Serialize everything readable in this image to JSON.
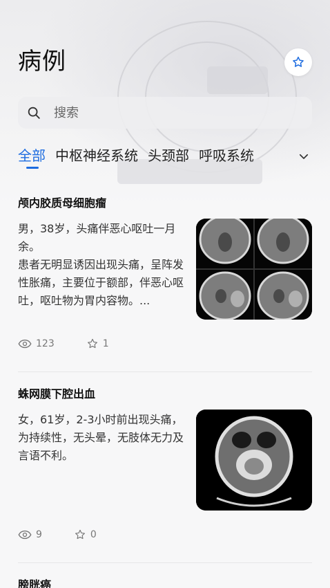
{
  "page": {
    "title": "病例"
  },
  "search": {
    "placeholder": "搜索"
  },
  "tabs": {
    "items": [
      "全部",
      "中枢神经系统",
      "头颈部",
      "呼吸系统"
    ],
    "active_index": 0
  },
  "cases": [
    {
      "title": "颅内胶质母细胞瘤",
      "description": "男，38岁，头痛伴恶心呕吐一月余。\n患者无明显诱因出现头痛，呈阵发性胀痛，主要位于额部，伴恶心呕吐，呕吐物为胃内容物。...",
      "views": "123",
      "favorites": "1"
    },
    {
      "title": "蛛网膜下腔出血",
      "description": "女，61岁，2-3小时前出现头痛，为持续性，无头晕，无肢体无力及言语不利。",
      "views": "9",
      "favorites": "0"
    },
    {
      "title": "膀胱癌"
    }
  ],
  "icons": {
    "favorite": "star-outline-icon",
    "search": "search-icon",
    "expand": "chevron-down-icon",
    "views": "eye-icon"
  },
  "colors": {
    "accent": "#1d6ce0",
    "background": "#f7f7f8"
  }
}
